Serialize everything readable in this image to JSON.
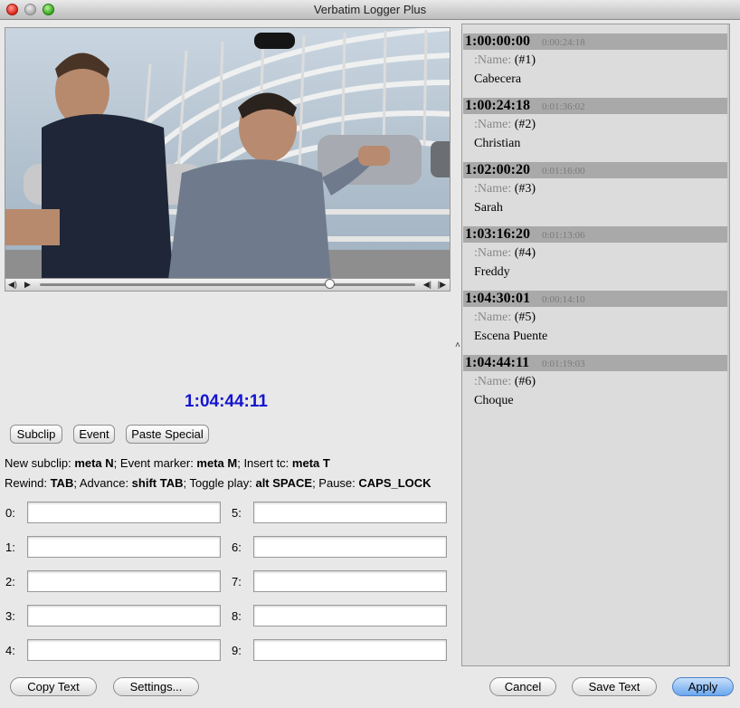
{
  "window": {
    "title": "Verbatim Logger Plus"
  },
  "video": {
    "playhead_fraction": 0.77
  },
  "timecode": "1:04:44:11",
  "buttons": {
    "subclip": "Subclip",
    "event": "Event",
    "paste_special": "Paste Special",
    "copy_text": "Copy Text",
    "settings": "Settings...",
    "cancel": "Cancel",
    "save_text": "Save Text",
    "apply": "Apply"
  },
  "shortcuts": {
    "line1": {
      "new_subclip": "New subclip: ",
      "new_subclip_key": "meta N",
      "event_marker": "; Event marker: ",
      "event_marker_key": "meta M",
      "insert_tc": "; Insert tc: ",
      "insert_tc_key": "meta T"
    },
    "line2": {
      "rewind": "Rewind: ",
      "rewind_key": "TAB",
      "advance": "; Advance: ",
      "advance_key": "shift TAB",
      "toggle": "; Toggle play: ",
      "toggle_key": "alt SPACE",
      "pause": "; Pause: ",
      "pause_key": "CAPS_LOCK"
    }
  },
  "fields": {
    "labels": [
      "0:",
      "1:",
      "2:",
      "3:",
      "4:",
      "5:",
      "6:",
      "7:",
      "8:",
      "9:"
    ],
    "values": [
      "",
      "",
      "",
      "",
      "",
      "",
      "",
      "",
      "",
      ""
    ]
  },
  "log_entries": [
    {
      "tc": "1:00:00:00",
      "duration": "0:00:24:18",
      "name_label": ":Name:",
      "name_num": "(#1)",
      "value": "Cabecera"
    },
    {
      "tc": "1:00:24:18",
      "duration": "0:01:36:02",
      "name_label": ":Name:",
      "name_num": "(#2)",
      "value": "Christian"
    },
    {
      "tc": "1:02:00:20",
      "duration": "0:01:16:00",
      "name_label": ":Name:",
      "name_num": "(#3)",
      "value": "Sarah"
    },
    {
      "tc": "1:03:16:20",
      "duration": "0:01:13:06",
      "name_label": ":Name:",
      "name_num": "(#4)",
      "value": "Freddy"
    },
    {
      "tc": "1:04:30:01",
      "duration": "0:00:14:10",
      "name_label": ":Name:",
      "name_num": "(#5)",
      "value": "Escena Puente"
    },
    {
      "tc": "1:04:44:11",
      "duration": "0:01:19:03",
      "name_label": ":Name:",
      "name_num": "(#6)",
      "value": "Choque"
    }
  ],
  "colors": {
    "timecode": "#1414d0",
    "entry_header": "#a9a9a9",
    "apply_button": "#6aa6ee"
  }
}
